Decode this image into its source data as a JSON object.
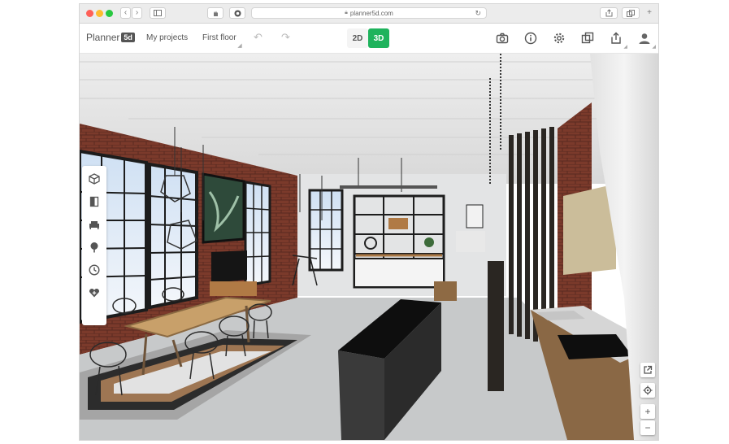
{
  "browser": {
    "url": "planner5d.com"
  },
  "app": {
    "logo_text": "Planner",
    "logo_badge": "5d",
    "nav": {
      "projects": "My projects",
      "floor": "First floor"
    },
    "modes": {
      "d2": "2D",
      "d3": "3D",
      "active": "3D"
    },
    "toolbar_icons": [
      "camera-icon",
      "info-icon",
      "settings-icon",
      "copy-icon",
      "share-icon",
      "user-icon"
    ]
  },
  "left_panel": {
    "icons": [
      "cube-icon",
      "door-icon",
      "sofa-icon",
      "tree-icon",
      "clock-icon",
      "favorite-icon"
    ]
  },
  "right_controls": {
    "icons": [
      "open-external-icon",
      "locate-icon",
      "zoom-in-icon",
      "zoom-out-icon"
    ],
    "zoom_in": "+",
    "zoom_out": "−"
  },
  "colors": {
    "accent": "#1eb35c",
    "brick": "#7d3a2a",
    "floor": "#c9cbcc"
  }
}
